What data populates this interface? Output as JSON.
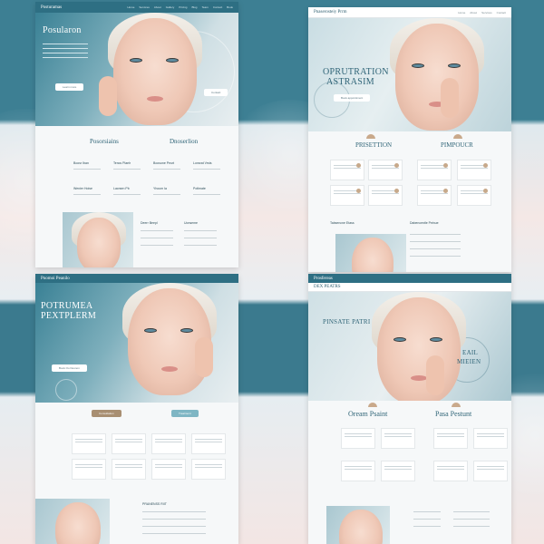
{
  "panels": {
    "top_left": {
      "brand": "Posturamas",
      "nav": [
        "Home",
        "Services",
        "About",
        "Gallery",
        "Pricing",
        "Blog",
        "Team",
        "Contact",
        "Book"
      ],
      "hero_title": "Posularon",
      "cta": "Learn more",
      "cta2": "Contact",
      "section_left": "Posorsiains",
      "section_right": "Dnoserlion",
      "features": [
        "Boosr Iban",
        "Tencs Plaelr",
        "Boosone Peurt",
        "Lonsrat Vrsts",
        "Wenier Hoise",
        "Lacrsen Pb",
        "Yhoum Ia",
        "Potlmate"
      ],
      "sub_left": "Deerr Beepl",
      "sub_right": "Uonseme"
    },
    "top_right": {
      "brand": "Pnaserosteiy Prrm",
      "nav": [
        "Home",
        "About",
        "Services",
        "Contact"
      ],
      "hero_title_1": "OPRUTRATION",
      "hero_title_2": "ASTRASIM",
      "cta": "Book appointment",
      "section_left": "PRISETTION",
      "section_right": "PIMPOUCR",
      "sub_left": "Tabsencne Etass",
      "sub_right": "Dabencentle Peinue"
    },
    "bottom_left": {
      "brand": "Pnomoi Peanilo",
      "hero_title_1": "POTRUMEA",
      "hero_title_2": "PEXTPLERM",
      "cta": "Book Oo Desnon",
      "btn_left": "Consultation",
      "btn_right": "Treatment",
      "sub_right": "PRANENSS RIIT"
    },
    "bottom_right": {
      "brand": "Prosfereas",
      "nav_label": "DEX PEATRS",
      "hero_title": "PINSATE PATRI",
      "hero_right_1": "EAIL",
      "hero_right_2": "MIEIEN",
      "section_left": "Oream Psaint",
      "section_right": "Pasa Pestunt"
    }
  },
  "colors": {
    "teal": "#3d7f93",
    "teal_dark": "#2f6477",
    "tan": "#a88f72",
    "card_dot": "#c7a98b"
  }
}
